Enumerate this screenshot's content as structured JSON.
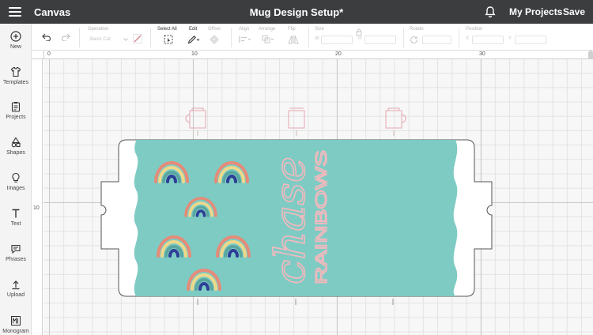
{
  "topbar": {
    "app_title": "Canvas",
    "doc_title": "Mug Design Setup*",
    "my_projects": "My Projects",
    "save": "Save",
    "icons": [
      "menu-icon",
      "bell-icon"
    ]
  },
  "sidebar": {
    "items": [
      {
        "label": "New",
        "icon": "plus-circle-icon"
      },
      {
        "label": "Templates",
        "icon": "tshirt-icon"
      },
      {
        "label": "Projects",
        "icon": "clipboard-icon"
      },
      {
        "label": "Shapes",
        "icon": "shapes-icon"
      },
      {
        "label": "Images",
        "icon": "lightbulb-icon"
      },
      {
        "label": "Text",
        "icon": "text-icon"
      },
      {
        "label": "Phrases",
        "icon": "speech-bubble-icon"
      },
      {
        "label": "Upload",
        "icon": "upload-icon"
      },
      {
        "label": "Monogram",
        "icon": "monogram-icon"
      }
    ]
  },
  "toolbar": {
    "operation_label": "Operation",
    "operation_value": "Basic Cut",
    "select_all_label": "Select All",
    "edit_label": "Edit",
    "offset_label": "Offset",
    "align_label": "Align",
    "arrange_label": "Arrange",
    "flip_label": "Flip",
    "size_label": "Size",
    "size_w": "W",
    "size_h": "H",
    "rotate_label": "Rotate",
    "position_label": "Position",
    "position_x": "X",
    "position_y": "Y"
  },
  "rulers": {
    "top": [
      "0",
      "10",
      "20",
      "30"
    ],
    "left": [
      "10"
    ]
  },
  "design": {
    "script_text": "chase",
    "block_text": "RAINBOWS",
    "background_color": "#7ecbc4",
    "text_color": "#f3b9bd"
  }
}
